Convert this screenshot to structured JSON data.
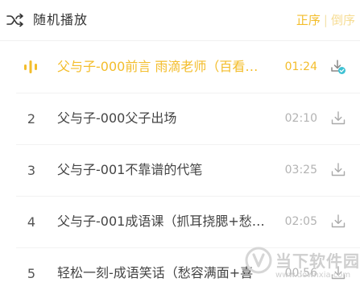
{
  "header": {
    "play_mode_label": "随机播放",
    "play_mode_icon": "shuffle-icon",
    "sort_asc_label": "正序",
    "sort_separator": "|",
    "sort_desc_label": "倒序"
  },
  "tracks": [
    {
      "index": "",
      "title": "父与子-000前言 雨滴老师（百看…",
      "duration": "01:24",
      "state": "playing",
      "downloaded": true
    },
    {
      "index": "2",
      "title": "父与子-000父子出场",
      "duration": "02:10",
      "state": "normal",
      "downloaded": false
    },
    {
      "index": "3",
      "title": "父与子-001不靠谱的代笔",
      "duration": "03:25",
      "state": "normal",
      "downloaded": false
    },
    {
      "index": "4",
      "title": "父与子-001成语课（抓耳挠腮+愁…",
      "duration": "02:05",
      "state": "normal",
      "downloaded": false
    },
    {
      "index": "5",
      "title": "轻松一刻-成语笑话（愁容满面+喜",
      "duration": "00:56",
      "state": "normal",
      "downloaded": false
    }
  ],
  "watermark": {
    "name": "当下软件园",
    "url": "www.downxia.com"
  },
  "colors": {
    "accent": "#f3bd2b",
    "text": "#444444",
    "muted": "#b3b3b3",
    "check_badge": "#3ec1d3"
  }
}
